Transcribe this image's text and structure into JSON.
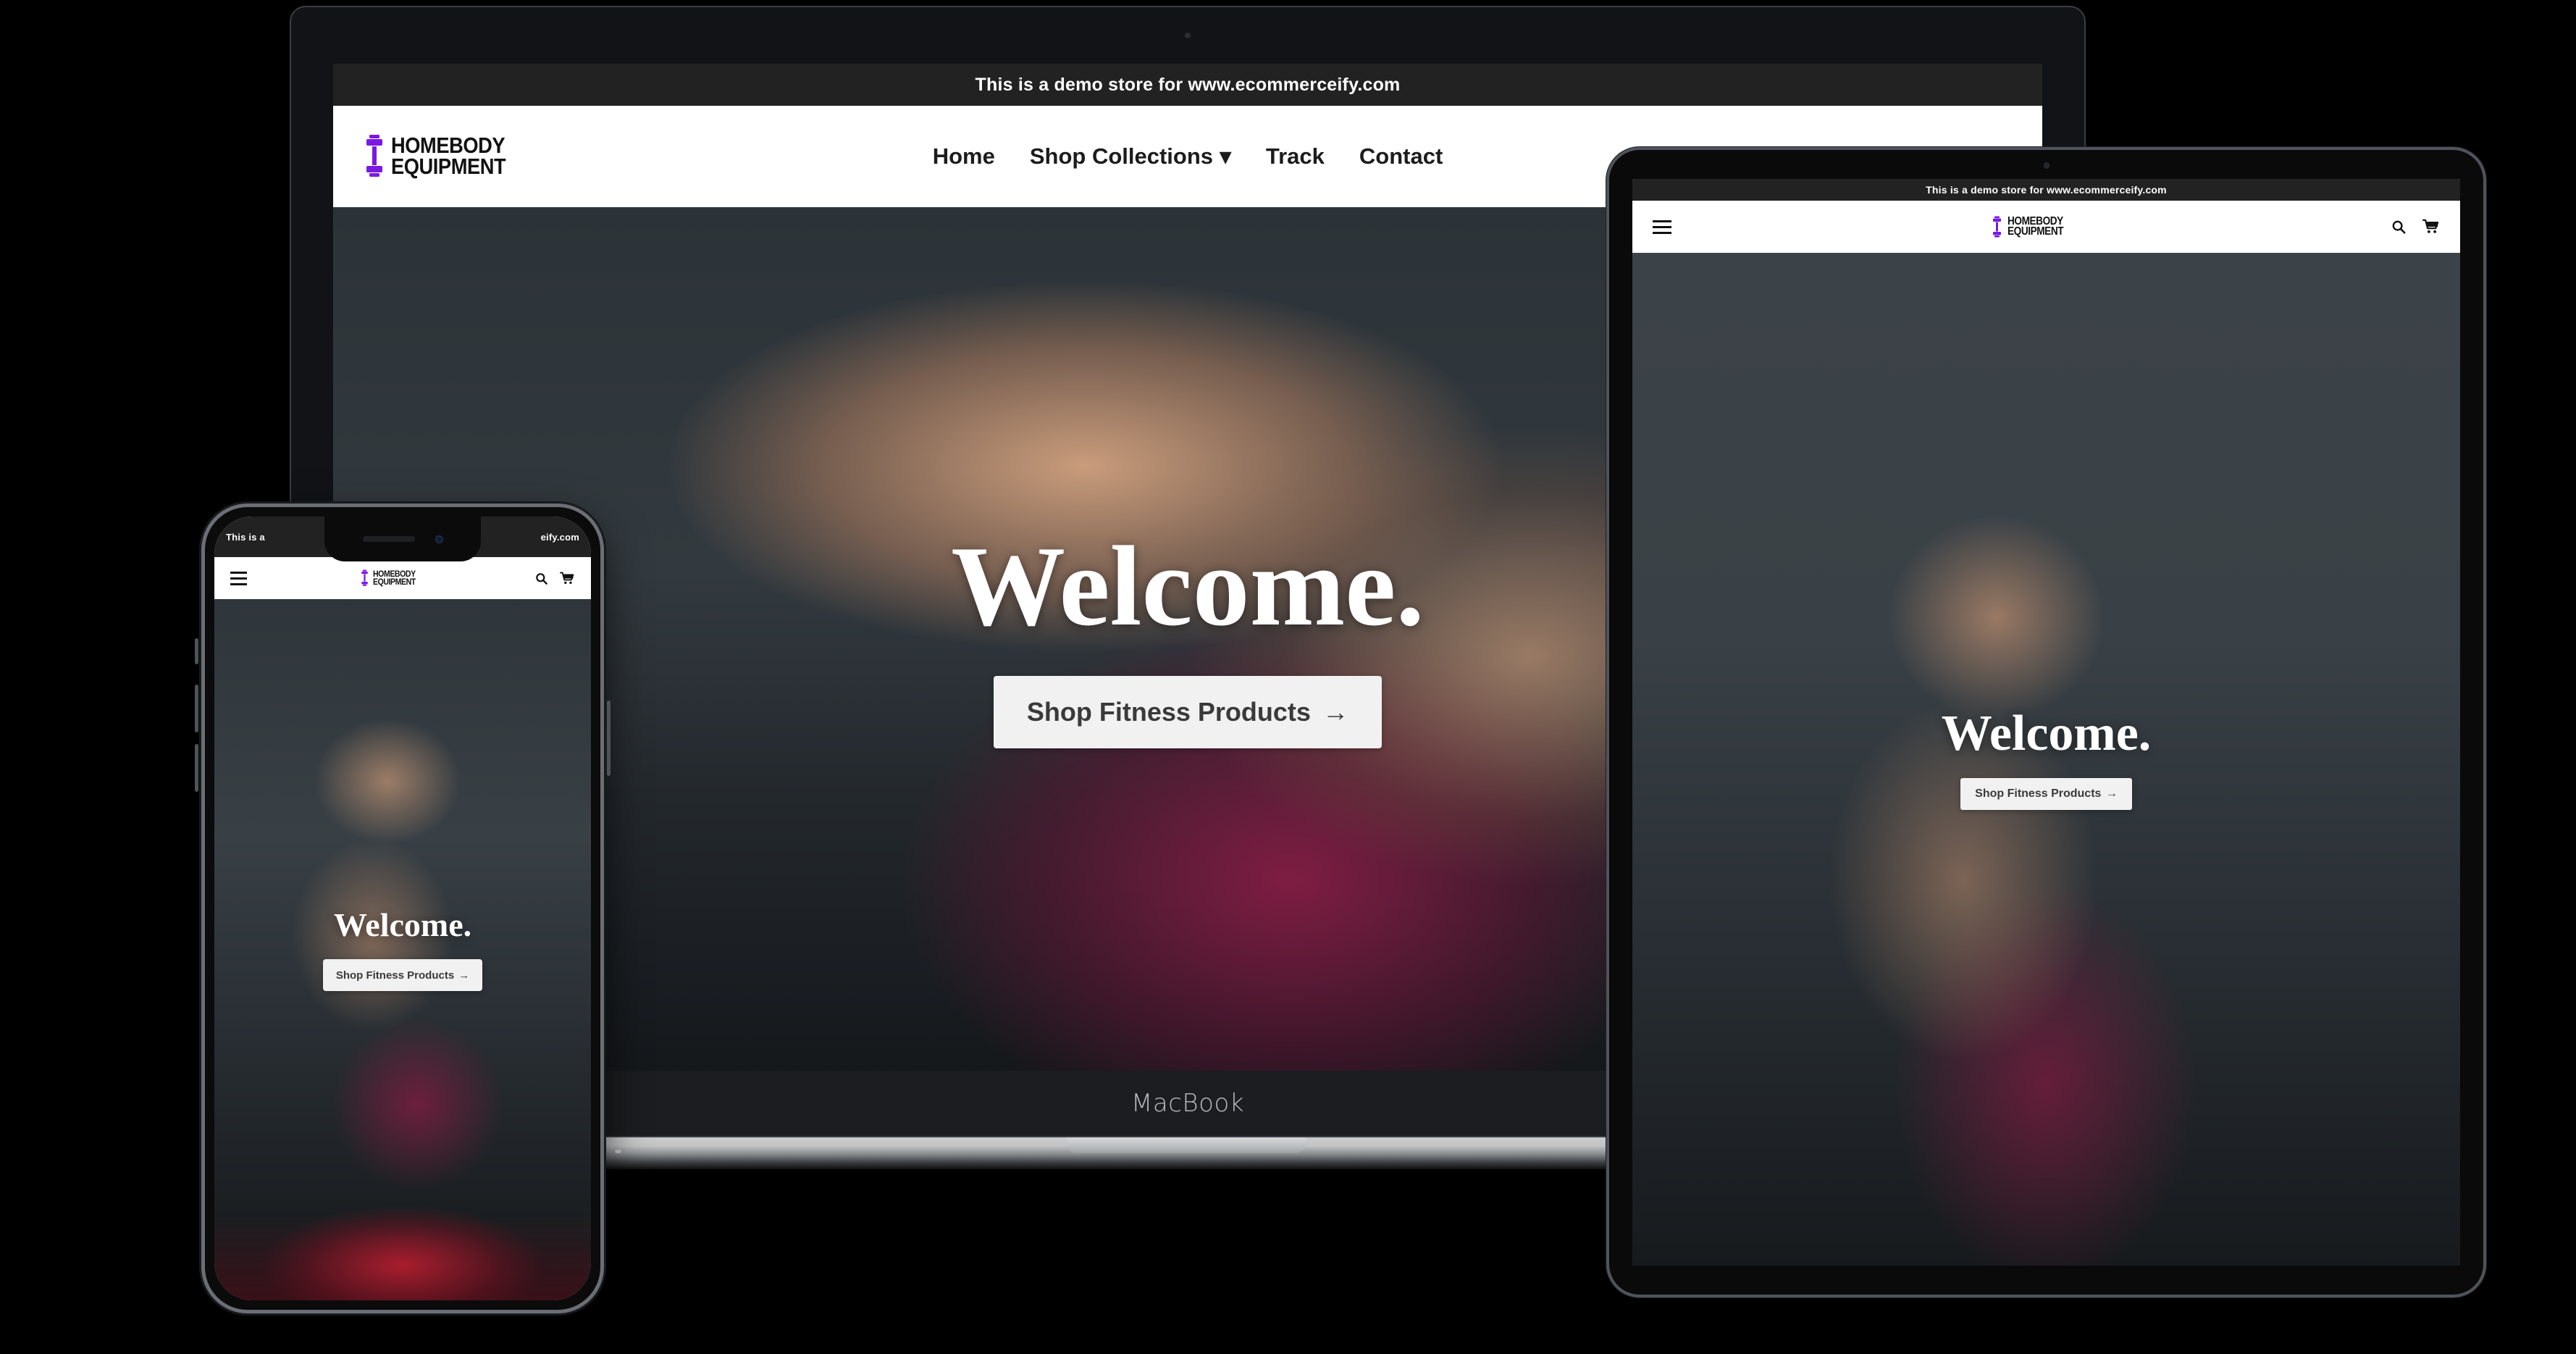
{
  "devices": {
    "macbook": {
      "label": "MacBook",
      "name": "macbook-device"
    },
    "tablet": {
      "label": "",
      "name": "tablet-device"
    },
    "phone": {
      "label": "",
      "name": "phone-device"
    }
  },
  "site": {
    "demo_banner": "This is a demo store for www.ecommerceify.com",
    "demo_banner_left_fragment": "This is a",
    "demo_banner_right_fragment": "eify.com",
    "brand": {
      "line1": "HOMEBODY",
      "line2": "EQUIPMENT",
      "logo_icon": "dumbbell-icon",
      "accent_color": "#7b19e0"
    },
    "nav": [
      {
        "label": "Home",
        "has_dropdown": false
      },
      {
        "label": "Shop Collections",
        "has_dropdown": true,
        "chevron": "▾"
      },
      {
        "label": "Track",
        "has_dropdown": false
      },
      {
        "label": "Contact",
        "has_dropdown": false
      }
    ],
    "mobile_icons": {
      "menu": "hamburger-icon",
      "search": "search-icon",
      "cart": "cart-icon"
    },
    "hero": {
      "title": "Welcome.",
      "cta_label": "Shop Fitness Products",
      "cta_arrow": "→",
      "background_alt": "woman-squatting-in-gym-photo",
      "overlay_color": "#252b30"
    }
  },
  "colors": {
    "banner_bg": "#222222",
    "header_bg": "#ffffff",
    "cta_bg": "#f1f1f1",
    "cta_text": "#3a3a3a",
    "brand_purple": "#7b19e0",
    "page_bg": "#000000"
  }
}
